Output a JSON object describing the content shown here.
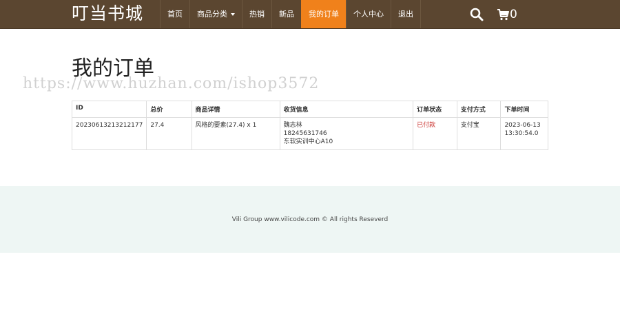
{
  "header": {
    "brand": "叮当书城",
    "nav": [
      {
        "label": "首页",
        "active": false
      },
      {
        "label": "商品分类",
        "active": false,
        "dropdown": true
      },
      {
        "label": "热销",
        "active": false
      },
      {
        "label": "新品",
        "active": false
      },
      {
        "label": "我的订单",
        "active": true
      },
      {
        "label": "个人中心",
        "active": false
      },
      {
        "label": "退出",
        "active": false
      }
    ],
    "search_icon": "search-icon",
    "cart_icon": "cart-icon",
    "cart_count": "0"
  },
  "main": {
    "title": "我的订单",
    "watermark": "https://www.huzhan.com/ishop3572",
    "table": {
      "headers": [
        "ID",
        "总价",
        "商品详情",
        "收货信息",
        "订单状态",
        "支付方式",
        "下单时间"
      ],
      "rows": [
        {
          "id": "20230613213212177",
          "total": "27.4",
          "details": "风格的要素(27.4) x 1",
          "receiver_name": "魏志林",
          "receiver_phone": "18245631746",
          "receiver_address": "东软实训中心A10",
          "status": "已付款",
          "payment": "支付宝",
          "date": "2023-06-13",
          "time": "13:30:54.0"
        }
      ]
    }
  },
  "footer": {
    "text": "Vili Group www.vilicode.com © All rights Reseverd"
  },
  "colors": {
    "navbar": "#5b4630",
    "active_nav": "#f0811b",
    "footer_bg": "#eef6f4",
    "status_paid": "#c9302c"
  }
}
